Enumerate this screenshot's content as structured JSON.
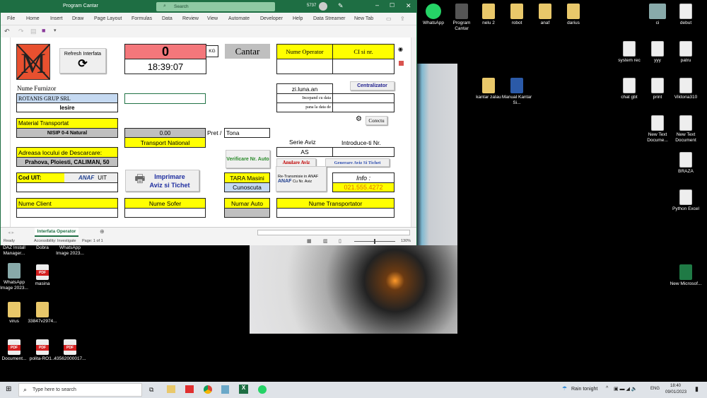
{
  "window": {
    "title": "Program Cantar",
    "search_placeholder": "Search",
    "user_code": "5737"
  },
  "ribbon": {
    "tabs": [
      "File",
      "Home",
      "Insert",
      "Draw",
      "Page Layout",
      "Formulas",
      "Data",
      "Review",
      "View",
      "Automate",
      "Developer",
      "Help",
      "Data Streamer",
      "New Tab"
    ]
  },
  "sheet": {
    "refresh_label": "Refresh Interfata",
    "weight": "0",
    "weight_unit": "KG",
    "time": "18:39:07",
    "cantar_label": "Cantar",
    "operator_header": "Nume Operator",
    "ci_header": "CI si nr.",
    "furnizor_label": "Nume Furnizor",
    "furnizor_value": "ROTANIS GRUP SRL",
    "direction": "Iesire",
    "date_format": "zi.luna.an",
    "start_date_label": "Incepand cu data",
    "end_date_label": "pana  la data de",
    "centralizator_label": "Centralizator",
    "corectii_label": "Corectu",
    "material_label": "Material Transportat",
    "material_value": "NISIP 0-4 Natural",
    "price_value": "0.00",
    "transport_type": "Transport National",
    "pret_label": "Pret /",
    "price_unit": "Tona",
    "serie_aviz_label": "Serie Aviz",
    "introduce_nr_label": "Introduce-ti Nr.",
    "serie_value": "AS",
    "anulare_label": "Anulare Aviz",
    "generare_label": "Generare Aviz Si Tichet",
    "verificare_label": "Verificare Nr. Auto",
    "adresa_label": "Adreasa locului de Descarcare:",
    "adresa_value": "Prahova, Ploiesti, CALIMAN, 50",
    "cod_uit_label": "Cod UIT:",
    "anaf_label": "ANAF",
    "uit_label": "UIT",
    "imprimare_label": "Imprimare",
    "imprimare_label2": "Aviz si Tichet",
    "tara_label": "TARA Masini",
    "tara_value": "Cunoscuta",
    "retransmisie_label": "Re-Transmisie in ANAF",
    "retransmisie_label2": "Cu Nr. Aviz",
    "info_label": "Info :",
    "info_phone": "021.555.4272",
    "client_label": "Nume Client",
    "sofer_label": "Nume Sofer",
    "numar_auto_label": "Numar Auto",
    "transportator_label": "Nume Transportator"
  },
  "sheet_tabs": [
    "Interfata Operator"
  ],
  "status": {
    "ready": "Ready",
    "accessibility": "Accessibility: Investigate",
    "page": "Page: 1 of 1",
    "zoom": "130%"
  },
  "desktop_icons": [
    "WhatsApp",
    "Program Cantar",
    "nelu 2",
    "robot",
    "anaf",
    "darius",
    "ci",
    "debut",
    "system rec",
    "yyy",
    "patru",
    "kantar zalau",
    "Manual Kantar Si...",
    "chat gbt",
    "print",
    "Viktoria310",
    "New Text Docume...",
    "New Text Document",
    "BRAZA",
    "Python Excel",
    "New Microsof...",
    "DAZ Install Manager...",
    "Dobra",
    "WhatsApp Image 2023...",
    "WhatsApp Image 2023...",
    "masina",
    "virus",
    "33847v2974...",
    "Document...",
    "polita-RO1...",
    "43562000017..."
  ],
  "taskbar": {
    "search_placeholder": "Type here to search",
    "weather": "Rain tonight",
    "lang": "ENG",
    "time": "18:40",
    "date": "09/01/2023"
  },
  "colors": {
    "excel_green": "#1e6e43",
    "yellow": "#ffff00",
    "red_weight": "#f4777b"
  }
}
